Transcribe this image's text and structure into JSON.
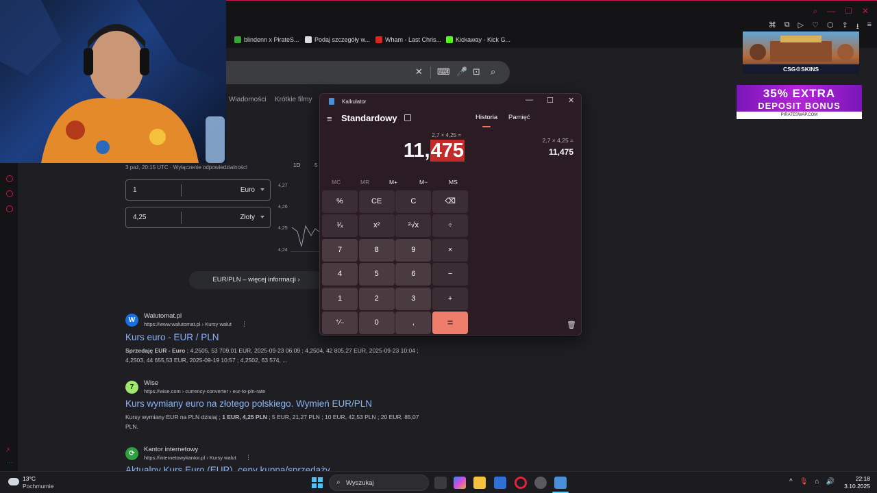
{
  "browser": {
    "bookmarks": [
      {
        "label": "blindenn x PirateS...",
        "color": "#3aa63a"
      },
      {
        "label": "Podaj szczegóły w...",
        "color": "#dddddd"
      },
      {
        "label": "Wham - Last Chris...",
        "color": "#e02424"
      },
      {
        "label": "Kickaway - Kick G...",
        "color": "#53fc18"
      }
    ],
    "accent": "#c8184a"
  },
  "google": {
    "tabs": [
      "Wiadomości",
      "Krótkie filmy"
    ],
    "rate_note": "3 paź, 20:15 UTC · Wyłączenie odpowiedzialności",
    "from": {
      "value": "1",
      "currency": "Euro"
    },
    "to": {
      "value": "4,25",
      "currency": "Złoty"
    },
    "range_buttons": [
      "1D",
      "5"
    ],
    "y_ticks": [
      "4,27",
      "4,26",
      "4,25",
      "4,24"
    ],
    "more_info": "EUR/PLN – więcej informacji",
    "results": [
      {
        "site": "Walutomat.pl",
        "url": "https://www.walutomat.pl › Kursy walut",
        "title": "Kurs euro - EUR / PLN",
        "snippet_bold": "Sprzedaję EUR - Euro",
        "snippet": " ; 4,2505, 53 709,01 EUR, 2025-09-23 06:09 ; 4,2504, 42 805,27 EUR, 2025-09-23 10:04 ; 4,2503, 44 655,53 EUR, 2025-09-19 10:57 ; 4,2502, 63 574, ...",
        "favicon_letter": "W",
        "favicon_color": "#1a6fe0"
      },
      {
        "site": "Wise",
        "url": "https://wise.com › currency-converter › eur-to-pln-rate",
        "title": "Kurs wymiany euro na złotego polskiego. Wymień EUR/PLN",
        "snippet_pre": "Kursy wymiany EUR na PLN dzisiaj ; ",
        "snippet_bold": "1 EUR, 4,25 PLN",
        "snippet": " ; 5 EUR, 21,27 PLN ; 10 EUR, 42,53 PLN ; 20 EUR, 85,07 PLN.",
        "favicon_letter": "7",
        "favicon_color": "#9fe870"
      },
      {
        "site": "Kantor internetowy",
        "url": "https://internetowykantor.pl › Kursy walut",
        "title": "Aktualny Kurs Euro (EUR), ceny kupna/sprzedaży",
        "favicon_letter": "⟳",
        "favicon_color": "#2ea043"
      }
    ]
  },
  "ads": {
    "ad1_label": "CSG⚙SKINS",
    "ad2_line1": "35% EXTRA",
    "ad2_line2": "DEPOSIT BONUS",
    "ad2_line3": "PIRATESWAP.COM"
  },
  "calculator": {
    "window_title": "Kalkulator",
    "mode": "Standardowy",
    "tab_history": "Historia",
    "tab_memory": "Pamięć",
    "expression": "2,7 × 4,25 =",
    "display_prefix": "11,",
    "display_selected": "475",
    "memory_buttons": [
      "MC",
      "MR",
      "M+",
      "M−",
      "MS"
    ],
    "keys": [
      [
        "%",
        "CE",
        "C",
        "⌫"
      ],
      [
        "¹⁄ₓ",
        "x²",
        "²√x",
        "÷"
      ],
      [
        "7",
        "8",
        "9",
        "×"
      ],
      [
        "4",
        "5",
        "6",
        "−"
      ],
      [
        "1",
        "2",
        "3",
        "+"
      ],
      [
        "⁺⁄₋",
        "0",
        ",",
        "="
      ]
    ],
    "history_expression": "2,7   ×   4,25 =",
    "history_result": "11,475",
    "accent": "#ef7d6c",
    "selection_color": "#c42b2b"
  },
  "taskbar": {
    "temp": "13°C",
    "weather": "Pochmurnie",
    "search": "Wyszukaj",
    "time": "22:18",
    "date": "3.10.2025"
  }
}
